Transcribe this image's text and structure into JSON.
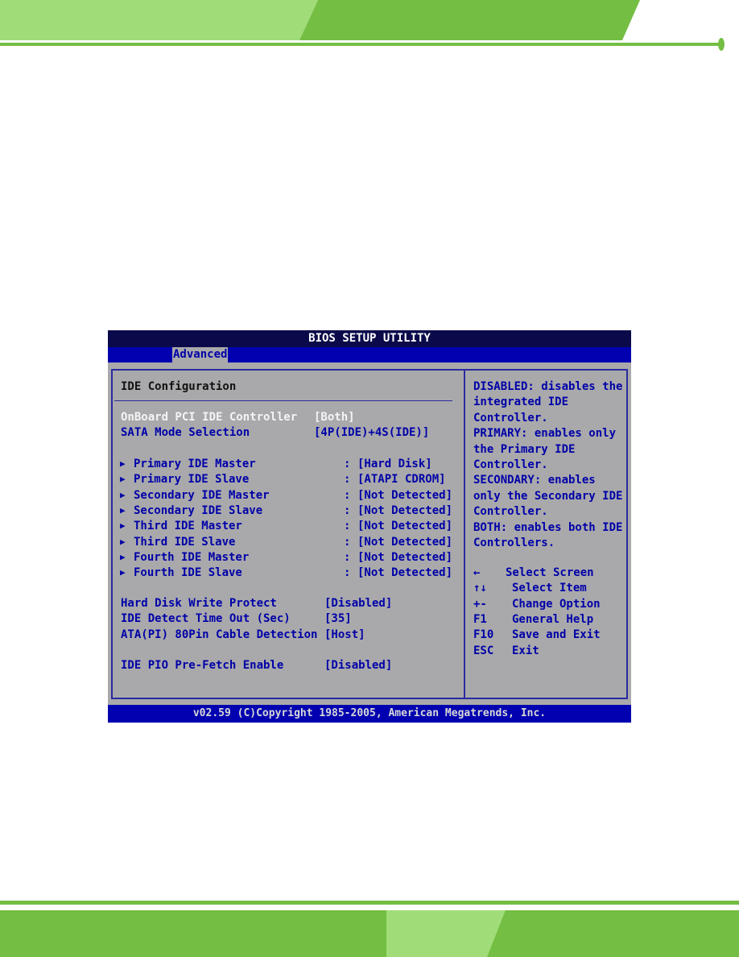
{
  "bios": {
    "title": "BIOS SETUP UTILITY",
    "tab": "Advanced",
    "section_title": "IDE Configuration",
    "settings_top": [
      {
        "label": "OnBoard PCI IDE Controller",
        "value": "[Both]",
        "selected": true
      },
      {
        "label": "SATA Mode Selection",
        "value": "[4P(IDE)+4S(IDE)]"
      }
    ],
    "devices": [
      {
        "label": "Primary IDE Master",
        "value": "[Hard Disk]"
      },
      {
        "label": "Primary IDE Slave",
        "value": "[ATAPI CDROM]"
      },
      {
        "label": "Secondary IDE Master",
        "value": "[Not Detected]"
      },
      {
        "label": "Secondary IDE Slave",
        "value": "[Not Detected]"
      },
      {
        "label": "Third IDE Master",
        "value": "[Not Detected]"
      },
      {
        "label": "Third IDE Slave",
        "value": "[Not Detected]"
      },
      {
        "label": "Fourth IDE Master",
        "value": "[Not Detected]"
      },
      {
        "label": "Fourth IDE Slave",
        "value": "[Not Detected]"
      }
    ],
    "settings_bottom": [
      {
        "label": "Hard Disk Write Protect",
        "value": "[Disabled]"
      },
      {
        "label": "IDE Detect Time Out (Sec)",
        "value": "[35]"
      },
      {
        "label": "ATA(PI) 80Pin Cable Detection",
        "value": "[Host]"
      }
    ],
    "settings_last": {
      "label": "IDE PIO Pre-Fetch Enable",
      "value": "[Disabled]"
    },
    "help_lines": [
      "DISABLED: disables the",
      "integrated IDE",
      "Controller.",
      "PRIMARY: enables only",
      "the Primary IDE",
      "Controller.",
      "SECONDARY: enables",
      "only the Secondary IDE",
      "Controller.",
      "BOTH: enables both IDE",
      "Controllers."
    ],
    "keys": [
      {
        "key": "←",
        "action": "Select Screen"
      },
      {
        "key": "↑↓",
        "action": "Select Item"
      },
      {
        "key": "+-",
        "action": "Change Option"
      },
      {
        "key": "F1",
        "action": "General Help"
      },
      {
        "key": "F10",
        "action": "Save and Exit"
      },
      {
        "key": "ESC",
        "action": "Exit"
      }
    ],
    "footer": "v02.59 (C)Copyright 1985-2005, American Megatrends, Inc."
  },
  "colors": {
    "green_light": "#a0dc78",
    "green_dark": "#74be44",
    "bios_blue": "#0000b0",
    "bios_gray": "#a9a9ab"
  }
}
